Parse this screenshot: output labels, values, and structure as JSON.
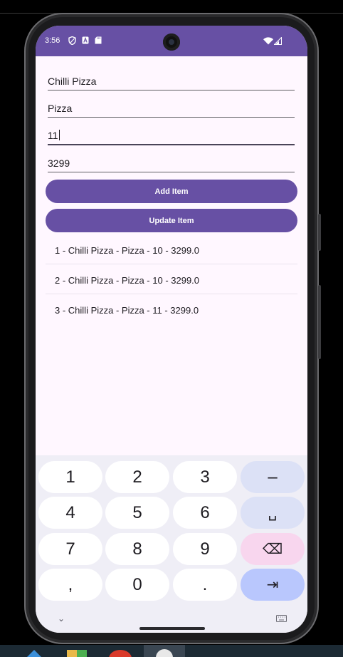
{
  "status_bar": {
    "time": "3:56",
    "left_icons": [
      "shield-icon",
      "a-badge-icon",
      "sd-card-icon"
    ],
    "right_icons": [
      "wifi-icon",
      "signal-icon"
    ],
    "color": "#6750A4"
  },
  "form": {
    "name_value": "Chilli Pizza",
    "category_value": "Pizza",
    "quantity_value": "11",
    "price_value": "3299"
  },
  "buttons": {
    "add_label": "Add Item",
    "update_label": "Update Item"
  },
  "items": [
    "1 - Chilli Pizza - Pizza - 10 - 3299.0",
    "2 - Chilli Pizza - Pizza - 10 - 3299.0",
    "3 - Chilli Pizza - Pizza - 11 - 3299.0"
  ],
  "keyboard": {
    "rows": [
      [
        "1",
        "2",
        "3",
        "–"
      ],
      [
        "4",
        "5",
        "6",
        "␣"
      ],
      [
        "7",
        "8",
        "9",
        "⌫"
      ],
      [
        ",",
        "0",
        ".",
        "⇥"
      ]
    ],
    "bottom_left": "⌄",
    "bottom_right": "keyboard-icon"
  },
  "colors": {
    "accent": "#6750A4",
    "screen_bg": "#FFF7FF",
    "keyboard_bg": "#EFEEF6"
  }
}
